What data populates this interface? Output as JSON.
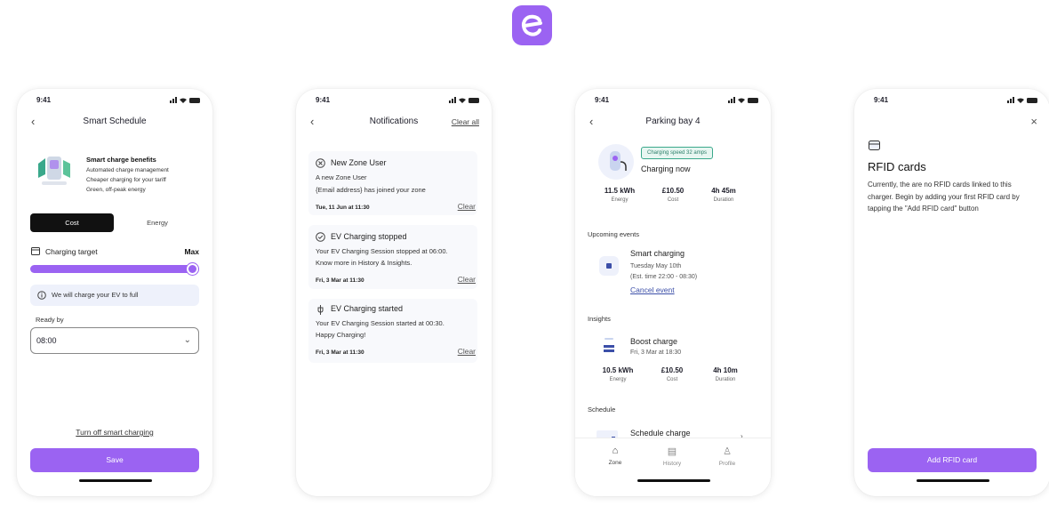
{
  "status": {
    "time": "9:41"
  },
  "colors": {
    "accent": "#9b63f2",
    "logo_bg": "#9b63f2",
    "charging_badge": "#3aa88b"
  },
  "logo": {
    "icon": "e-brand-icon"
  },
  "smart_schedule": {
    "title": "Smart Schedule",
    "benefits_title": "Smart charge benefits",
    "benefits": [
      "Automated charge management",
      "Cheaper charging for your tariff",
      "Green, off-peak energy"
    ],
    "tab_cost": "Cost",
    "tab_energy": "Energy",
    "target_label": "Charging target",
    "target_value": "Max",
    "target_fill": 1.0,
    "info": "We will charge your EV to full",
    "ready_label": "Ready by",
    "ready_value": "08:00",
    "turn_off": "Turn off smart charging",
    "save": "Save"
  },
  "notifications": {
    "title": "Notifications",
    "clear_all": "Clear all",
    "items": [
      {
        "title": "New Zone User",
        "body1": "A new Zone User",
        "body2": "{Email address} has joined your zone",
        "date": "Tue, 11 Jun at 11:30",
        "clear": "Clear",
        "icon": "circle-x-icon"
      },
      {
        "title": "EV Charging stopped",
        "body1": "Your EV Charging Session stopped at 06:00.",
        "body2": "Know more in History & Insights.",
        "date": "Fri, 3 Mar at 11:30",
        "clear": "Clear",
        "icon": "check-circle-icon"
      },
      {
        "title": "EV Charging started",
        "body1": "Your EV Charging Session started at 00:30.",
        "body2": "Happy Charging!",
        "date": "Fri, 3 Mar at 11:30",
        "clear": "Clear",
        "icon": "plug-icon"
      }
    ]
  },
  "parking": {
    "title": "Parking bay 4",
    "speed_badge": "Charging speed 32 amps",
    "status": "Charging now",
    "stats": [
      {
        "value": "11.5 kWh",
        "label": "Energy"
      },
      {
        "value": "£10.50",
        "label": "Cost"
      },
      {
        "value": "4h 45m",
        "label": "Duration"
      }
    ],
    "upcoming_label": "Upcoming events",
    "event_title": "Smart charging",
    "event_date": "Tuesday May 10th",
    "event_time": "(Est. time 22:00 - 08:30)",
    "event_cancel": "Cancel event",
    "insights_label": "Insights",
    "insight_title": "Boost charge",
    "insight_date": "Fri, 3 Mar at 18:30",
    "insight_stats": [
      {
        "value": "10.5 kWh",
        "label": "Energy"
      },
      {
        "value": "£10.50",
        "label": "Cost"
      },
      {
        "value": "4h 10m",
        "label": "Duration"
      }
    ],
    "schedule_label": "Schedule",
    "schedule_title": "Schedule charge",
    "nav": [
      {
        "label": "Zone",
        "icon": "home-icon"
      },
      {
        "label": "History",
        "icon": "receipt-icon"
      },
      {
        "label": "Profile",
        "icon": "user-icon"
      }
    ]
  },
  "rfid": {
    "title": "RFID cards",
    "body": "Currently, the are no RFID cards linked to this charger. Begin by adding your first RFID card by tapping the \"Add RFID card\" button",
    "add": "Add RFID card"
  }
}
